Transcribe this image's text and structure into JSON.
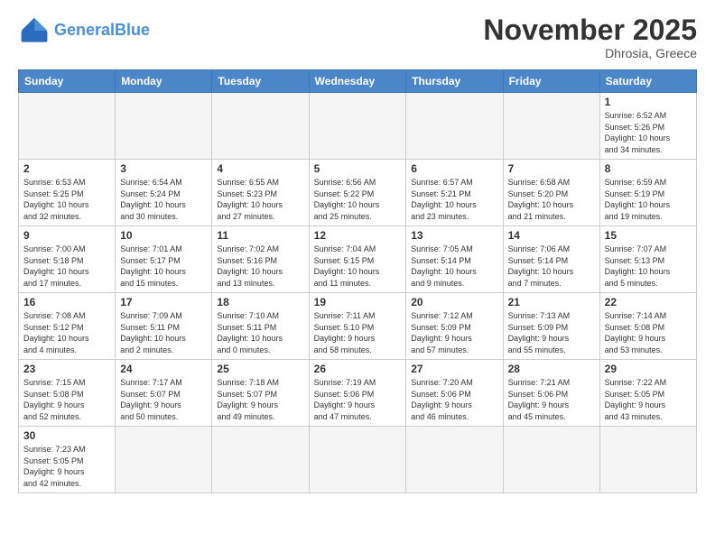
{
  "logo": {
    "text_general": "General",
    "text_blue": "Blue"
  },
  "header": {
    "month_title": "November 2025",
    "subtitle": "Dhrosia, Greece"
  },
  "weekdays": [
    "Sunday",
    "Monday",
    "Tuesday",
    "Wednesday",
    "Thursday",
    "Friday",
    "Saturday"
  ],
  "weeks": [
    [
      {
        "day": "",
        "info": ""
      },
      {
        "day": "",
        "info": ""
      },
      {
        "day": "",
        "info": ""
      },
      {
        "day": "",
        "info": ""
      },
      {
        "day": "",
        "info": ""
      },
      {
        "day": "",
        "info": ""
      },
      {
        "day": "1",
        "info": "Sunrise: 6:52 AM\nSunset: 5:26 PM\nDaylight: 10 hours\nand 34 minutes."
      }
    ],
    [
      {
        "day": "2",
        "info": "Sunrise: 6:53 AM\nSunset: 5:25 PM\nDaylight: 10 hours\nand 32 minutes."
      },
      {
        "day": "3",
        "info": "Sunrise: 6:54 AM\nSunset: 5:24 PM\nDaylight: 10 hours\nand 30 minutes."
      },
      {
        "day": "4",
        "info": "Sunrise: 6:55 AM\nSunset: 5:23 PM\nDaylight: 10 hours\nand 27 minutes."
      },
      {
        "day": "5",
        "info": "Sunrise: 6:56 AM\nSunset: 5:22 PM\nDaylight: 10 hours\nand 25 minutes."
      },
      {
        "day": "6",
        "info": "Sunrise: 6:57 AM\nSunset: 5:21 PM\nDaylight: 10 hours\nand 23 minutes."
      },
      {
        "day": "7",
        "info": "Sunrise: 6:58 AM\nSunset: 5:20 PM\nDaylight: 10 hours\nand 21 minutes."
      },
      {
        "day": "8",
        "info": "Sunrise: 6:59 AM\nSunset: 5:19 PM\nDaylight: 10 hours\nand 19 minutes."
      }
    ],
    [
      {
        "day": "9",
        "info": "Sunrise: 7:00 AM\nSunset: 5:18 PM\nDaylight: 10 hours\nand 17 minutes."
      },
      {
        "day": "10",
        "info": "Sunrise: 7:01 AM\nSunset: 5:17 PM\nDaylight: 10 hours\nand 15 minutes."
      },
      {
        "day": "11",
        "info": "Sunrise: 7:02 AM\nSunset: 5:16 PM\nDaylight: 10 hours\nand 13 minutes."
      },
      {
        "day": "12",
        "info": "Sunrise: 7:04 AM\nSunset: 5:15 PM\nDaylight: 10 hours\nand 11 minutes."
      },
      {
        "day": "13",
        "info": "Sunrise: 7:05 AM\nSunset: 5:14 PM\nDaylight: 10 hours\nand 9 minutes."
      },
      {
        "day": "14",
        "info": "Sunrise: 7:06 AM\nSunset: 5:14 PM\nDaylight: 10 hours\nand 7 minutes."
      },
      {
        "day": "15",
        "info": "Sunrise: 7:07 AM\nSunset: 5:13 PM\nDaylight: 10 hours\nand 5 minutes."
      }
    ],
    [
      {
        "day": "16",
        "info": "Sunrise: 7:08 AM\nSunset: 5:12 PM\nDaylight: 10 hours\nand 4 minutes."
      },
      {
        "day": "17",
        "info": "Sunrise: 7:09 AM\nSunset: 5:11 PM\nDaylight: 10 hours\nand 2 minutes."
      },
      {
        "day": "18",
        "info": "Sunrise: 7:10 AM\nSunset: 5:11 PM\nDaylight: 10 hours\nand 0 minutes."
      },
      {
        "day": "19",
        "info": "Sunrise: 7:11 AM\nSunset: 5:10 PM\nDaylight: 9 hours\nand 58 minutes."
      },
      {
        "day": "20",
        "info": "Sunrise: 7:12 AM\nSunset: 5:09 PM\nDaylight: 9 hours\nand 57 minutes."
      },
      {
        "day": "21",
        "info": "Sunrise: 7:13 AM\nSunset: 5:09 PM\nDaylight: 9 hours\nand 55 minutes."
      },
      {
        "day": "22",
        "info": "Sunrise: 7:14 AM\nSunset: 5:08 PM\nDaylight: 9 hours\nand 53 minutes."
      }
    ],
    [
      {
        "day": "23",
        "info": "Sunrise: 7:15 AM\nSunset: 5:08 PM\nDaylight: 9 hours\nand 52 minutes."
      },
      {
        "day": "24",
        "info": "Sunrise: 7:17 AM\nSunset: 5:07 PM\nDaylight: 9 hours\nand 50 minutes."
      },
      {
        "day": "25",
        "info": "Sunrise: 7:18 AM\nSunset: 5:07 PM\nDaylight: 9 hours\nand 49 minutes."
      },
      {
        "day": "26",
        "info": "Sunrise: 7:19 AM\nSunset: 5:06 PM\nDaylight: 9 hours\nand 47 minutes."
      },
      {
        "day": "27",
        "info": "Sunrise: 7:20 AM\nSunset: 5:06 PM\nDaylight: 9 hours\nand 46 minutes."
      },
      {
        "day": "28",
        "info": "Sunrise: 7:21 AM\nSunset: 5:06 PM\nDaylight: 9 hours\nand 45 minutes."
      },
      {
        "day": "29",
        "info": "Sunrise: 7:22 AM\nSunset: 5:05 PM\nDaylight: 9 hours\nand 43 minutes."
      }
    ],
    [
      {
        "day": "30",
        "info": "Sunrise: 7:23 AM\nSunset: 5:05 PM\nDaylight: 9 hours\nand 42 minutes."
      },
      {
        "day": "",
        "info": ""
      },
      {
        "day": "",
        "info": ""
      },
      {
        "day": "",
        "info": ""
      },
      {
        "day": "",
        "info": ""
      },
      {
        "day": "",
        "info": ""
      },
      {
        "day": "",
        "info": ""
      }
    ]
  ]
}
